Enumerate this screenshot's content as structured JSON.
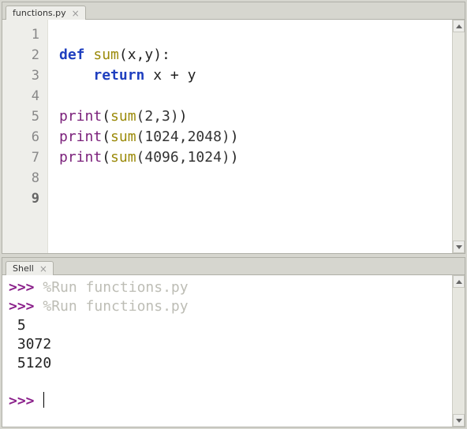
{
  "editor": {
    "tab_label": "functions.py",
    "line_numbers": [
      "1",
      "2",
      "3",
      "4",
      "5",
      "6",
      "7",
      "8",
      "9"
    ],
    "current_line": 9,
    "code": {
      "l1": "",
      "l2": {
        "kw_def": "def",
        "fn": "sum",
        "args": "(x,y):"
      },
      "l3": {
        "indent": "    ",
        "kw_return": "return",
        "expr": " x + y"
      },
      "l4": "",
      "l5": {
        "builtin": "print",
        "open": "(",
        "fn": "sum",
        "args": "(2,3)",
        "close": ")"
      },
      "l6": {
        "builtin": "print",
        "open": "(",
        "fn": "sum",
        "args": "(1024,2048)",
        "close": ")"
      },
      "l7": {
        "builtin": "print",
        "open": "(",
        "fn": "sum",
        "args": "(4096,1024)",
        "close": ")"
      },
      "l8": "",
      "l9": ""
    }
  },
  "shell": {
    "tab_label": "Shell",
    "lines": {
      "run1_prompt": ">>> ",
      "run1_cmd": "%Run functions.py",
      "run2_prompt": ">>> ",
      "run2_cmd": "%Run functions.py",
      "out1": " 5",
      "out2": " 3072",
      "out3": " 5120",
      "ready_prompt": ">>> "
    }
  }
}
